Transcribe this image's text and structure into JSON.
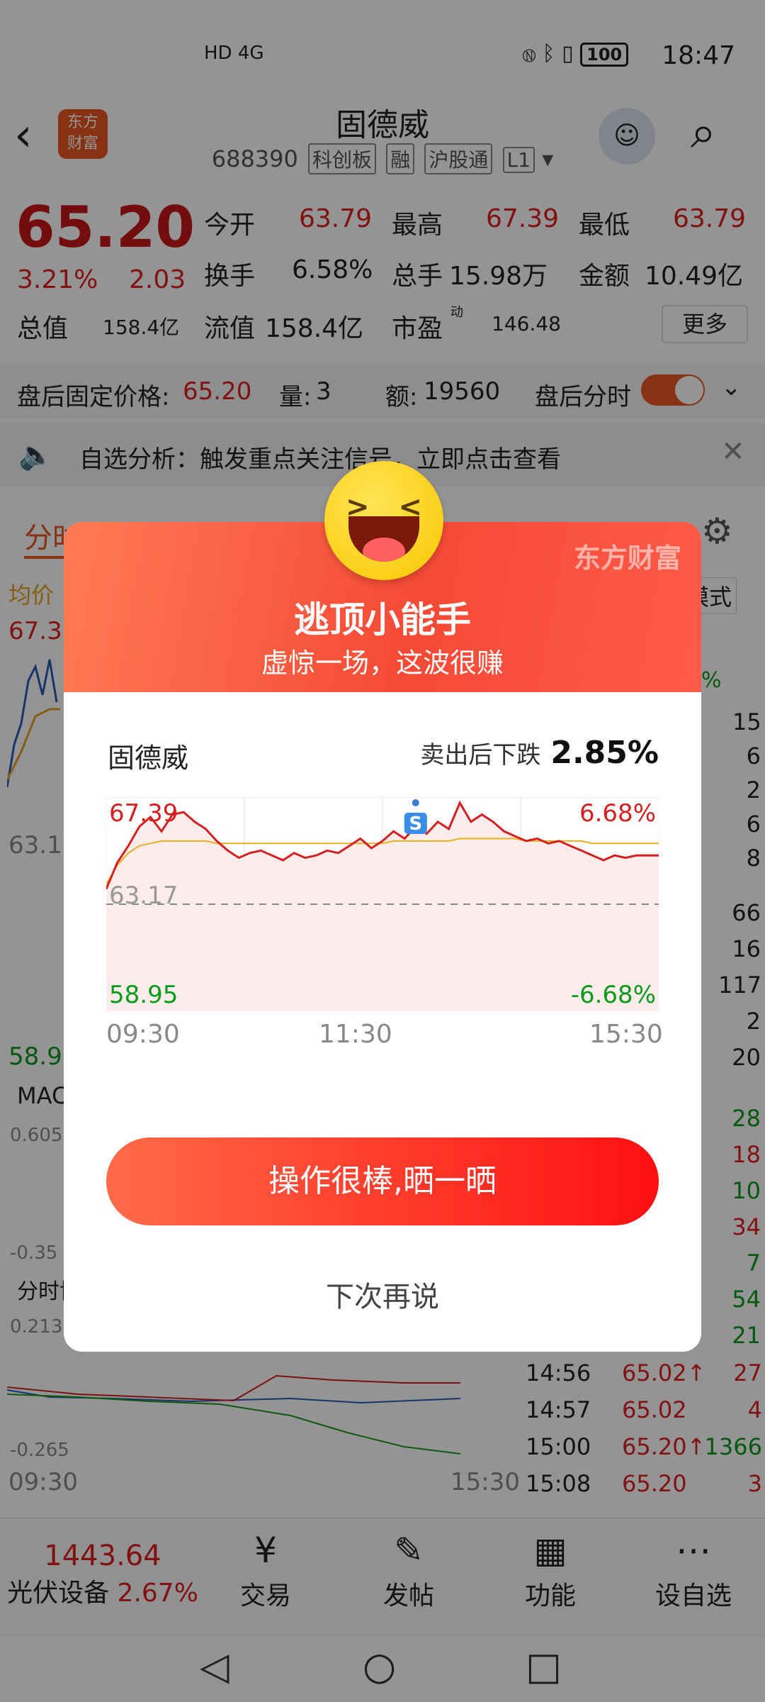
{
  "status_bar": {
    "time": "18:47",
    "network": "HD 4G",
    "battery": "100"
  },
  "header": {
    "stock_name": "固德威",
    "stock_code": "688390",
    "tags": [
      "科创板",
      "融",
      "沪股通",
      "L1"
    ],
    "logo_text_1": "东方",
    "logo_text_2": "财富"
  },
  "quote": {
    "price": "65.20",
    "change_pct": "3.21%",
    "change_amt": "2.03",
    "open_label": "今开",
    "open": "63.79",
    "high_label": "最高",
    "high": "67.39",
    "low_label": "最低",
    "low": "63.79",
    "turnover_label": "换手",
    "turnover": "6.58%",
    "volume_label": "总手",
    "volume": "15.98万",
    "amount_label": "金额",
    "amount": "10.49亿",
    "mktcap_label": "总值",
    "mktcap": "158.4亿",
    "float_label": "流值",
    "float": "158.4亿",
    "pe_label": "市盈",
    "pe_sup": "动",
    "pe": "146.48",
    "more": "更多"
  },
  "after_hours": {
    "price_label": "盘后固定价格:",
    "price": "65.20",
    "vol_label": "量:",
    "vol": "3",
    "amt_label": "额:",
    "amt": "19560",
    "toggle_label": "盘后分时"
  },
  "notice": {
    "text": "自选分析：触发重点关注信号，立即点击查看"
  },
  "tabs": {
    "first": "分时",
    "mode": "模式"
  },
  "background_chart": {
    "avg_label": "均价",
    "y_top": "67.39",
    "y_mid": "63.1",
    "y_bottom": "58.9",
    "macd_label": "MAC",
    "macd_top": "0.605",
    "macd_bottom": "-0.35",
    "flow_label": "分时博",
    "flow_top": "0.213",
    "flow_bottom": "-0.265",
    "time_start": "09:30",
    "time_end": "15:30",
    "right_pct": "%"
  },
  "ticks": [
    {
      "time": "14:56",
      "price": "65.02↑",
      "vol": "27"
    },
    {
      "time": "14:57",
      "price": "65.02",
      "vol": "4"
    },
    {
      "time": "15:00",
      "price": "65.20↑",
      "vol": "1366"
    },
    {
      "time": "15:08",
      "price": "65.20",
      "vol": "3"
    }
  ],
  "right_column_numbers": [
    "15",
    "6",
    "2",
    "6",
    "8",
    "66",
    "16",
    "117",
    "2",
    "20",
    "28",
    "18",
    "10",
    "34",
    "7",
    "54",
    "21"
  ],
  "bottom_nav": {
    "index_value": "1443.64",
    "index_name": "光伏设备",
    "index_pct": "2.67%",
    "trade": "交易",
    "post": "发帖",
    "function": "功能",
    "add_watch": "设自选"
  },
  "dialog": {
    "brand": "东方财富",
    "title": "逃顶小能手",
    "subtitle": "虚惊一场，这波很赚",
    "stock_name": "固德威",
    "drop_label": "卖出后下跌",
    "drop_value": "2.85%",
    "share_button": "操作很棒,晒一晒",
    "later_button": "下次再说"
  },
  "chart_data": {
    "type": "line",
    "title": "",
    "x": [
      "09:30",
      "11:30",
      "15:30"
    ],
    "ylim": [
      58.95,
      67.39
    ],
    "y_labels": {
      "top": "67.39",
      "mid": "63.17",
      "bottom": "58.95"
    },
    "pct_labels": {
      "top": "6.68%",
      "bottom": "-6.68%"
    },
    "reference_price": 63.17,
    "sell_marker": {
      "label": "S",
      "price": 67.39,
      "time_fraction": 0.56
    },
    "series": [
      {
        "color": "#d42020",
        "values": [
          63.8,
          64.9,
          65.6,
          66.4,
          66.8,
          66.2,
          66.9,
          67.0,
          66.6,
          66.3,
          65.8,
          65.4,
          65.1,
          65.3,
          65.4,
          65.2,
          65.0,
          65.3,
          65.1,
          65.2,
          65.4,
          65.3,
          65.6,
          65.9,
          65.5,
          65.8,
          66.2,
          65.9,
          66.4,
          66.1,
          66.6,
          66.3,
          67.39,
          66.6,
          66.9,
          66.6,
          66.2,
          66.0,
          65.8,
          65.9,
          65.7,
          65.8,
          65.6,
          65.4,
          65.2,
          65.0,
          65.2,
          65.1,
          65.2,
          65.2,
          65.2
        ]
      },
      {
        "color": "#e8b020",
        "values": [
          64.0,
          64.8,
          65.3,
          65.6,
          65.7,
          65.8,
          65.8,
          65.8,
          65.8,
          65.8,
          65.7,
          65.7,
          65.7,
          65.7,
          65.7,
          65.7,
          65.7,
          65.7,
          65.7,
          65.7,
          65.7,
          65.7,
          65.7,
          65.7,
          65.7,
          65.7,
          65.8,
          65.8,
          65.8,
          65.8,
          65.8,
          65.8,
          65.9,
          65.9,
          65.9,
          65.9,
          65.9,
          65.9,
          65.8,
          65.8,
          65.8,
          65.8,
          65.8,
          65.8,
          65.7,
          65.7,
          65.7,
          65.7,
          65.7,
          65.7,
          65.7
        ]
      }
    ]
  }
}
